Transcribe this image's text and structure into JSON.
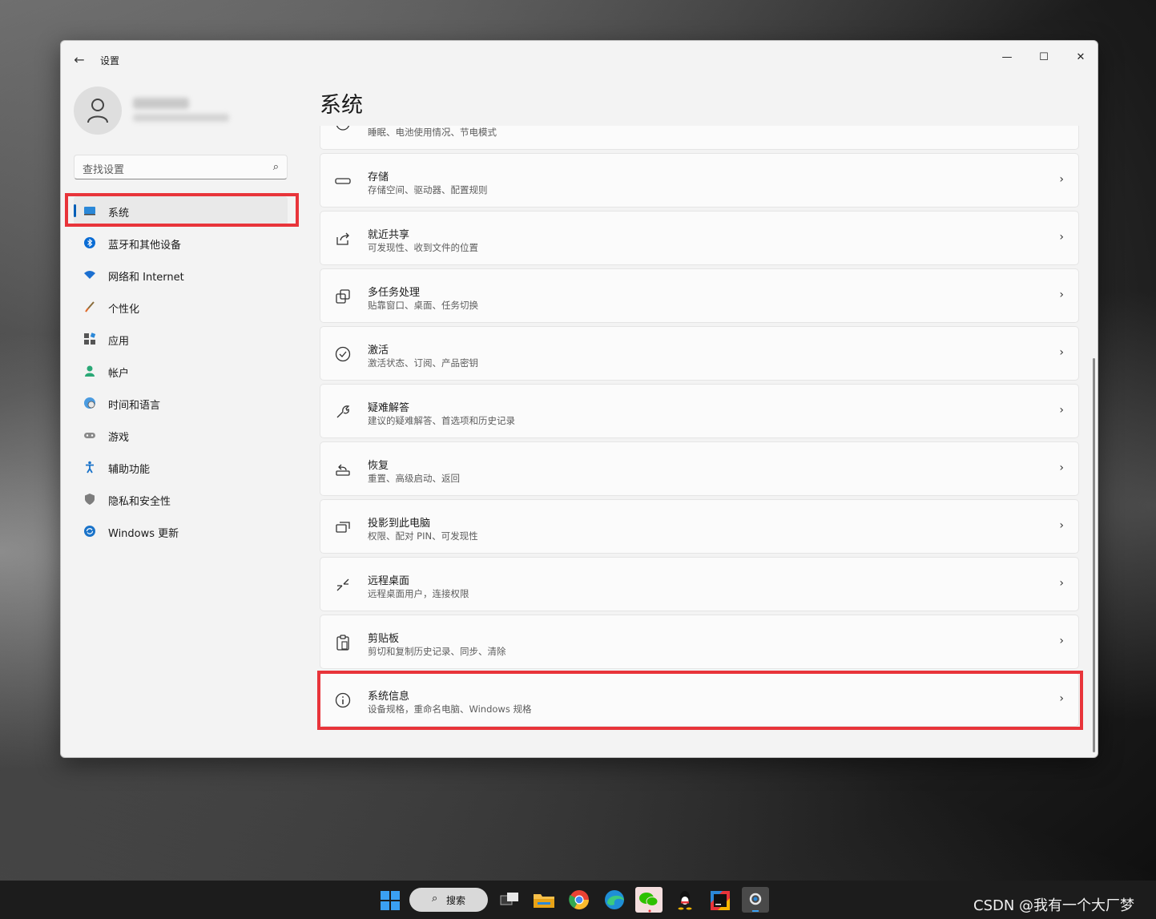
{
  "window": {
    "title": "设置",
    "controls": {
      "minimize": "—",
      "maximize": "☐",
      "close": "✕"
    }
  },
  "search": {
    "placeholder": "查找设置"
  },
  "nav": {
    "items": [
      {
        "label": "系统",
        "icon": "system-display-icon",
        "active": true
      },
      {
        "label": "蓝牙和其他设备",
        "icon": "bluetooth-icon"
      },
      {
        "label": "网络和 Internet",
        "icon": "wifi-icon"
      },
      {
        "label": "个性化",
        "icon": "brush-icon"
      },
      {
        "label": "应用",
        "icon": "apps-icon"
      },
      {
        "label": "帐户",
        "icon": "account-icon"
      },
      {
        "label": "时间和语言",
        "icon": "globe-clock-icon"
      },
      {
        "label": "游戏",
        "icon": "gamepad-icon"
      },
      {
        "label": "辅助功能",
        "icon": "accessibility-icon"
      },
      {
        "label": "隐私和安全性",
        "icon": "shield-icon"
      },
      {
        "label": "Windows 更新",
        "icon": "update-icon"
      }
    ]
  },
  "main": {
    "title": "系统",
    "cards": [
      {
        "title": "",
        "subtitle": "睡眠、电池使用情况、节电模式",
        "icon": "power-icon"
      },
      {
        "title": "存储",
        "subtitle": "存储空间、驱动器、配置规则",
        "icon": "storage-icon"
      },
      {
        "title": "就近共享",
        "subtitle": "可发现性、收到文件的位置",
        "icon": "share-icon"
      },
      {
        "title": "多任务处理",
        "subtitle": "贴靠窗口、桌面、任务切换",
        "icon": "multitask-icon"
      },
      {
        "title": "激活",
        "subtitle": "激活状态、订阅、产品密钥",
        "icon": "check-circle-icon"
      },
      {
        "title": "疑难解答",
        "subtitle": "建议的疑难解答、首选项和历史记录",
        "icon": "wrench-icon"
      },
      {
        "title": "恢复",
        "subtitle": "重置、高级启动、返回",
        "icon": "recovery-icon"
      },
      {
        "title": "投影到此电脑",
        "subtitle": "权限、配对 PIN、可发现性",
        "icon": "project-icon"
      },
      {
        "title": "远程桌面",
        "subtitle": "远程桌面用户，连接权限",
        "icon": "remote-desktop-icon"
      },
      {
        "title": "剪贴板",
        "subtitle": "剪切和复制历史记录、同步、清除",
        "icon": "clipboard-icon"
      },
      {
        "title": "系统信息",
        "subtitle": "设备规格，重命名电脑、Windows 规格",
        "icon": "info-icon"
      }
    ]
  },
  "taskbar": {
    "search_label": "搜索",
    "apps": [
      "start-icon",
      "task-view-icon",
      "file-explorer-icon",
      "chrome-icon",
      "edge-icon",
      "wechat-icon",
      "qq-icon",
      "intellij-icon",
      "settings-icon"
    ]
  },
  "watermark": "CSDN @我有一个大厂梦",
  "colors": {
    "accent": "#005fb8",
    "highlight": "#e8343a"
  }
}
